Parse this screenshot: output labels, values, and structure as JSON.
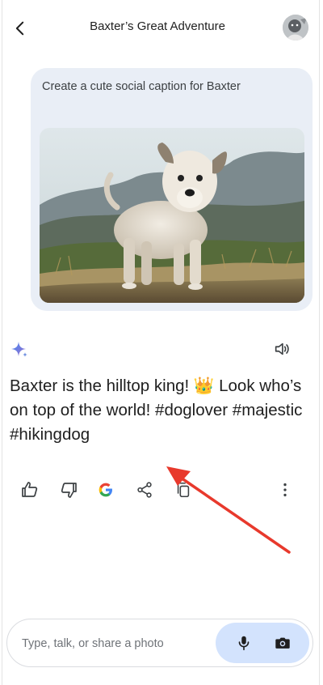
{
  "header": {
    "title": "Baxter’s Great Adventure",
    "back_icon": "back-arrow-icon",
    "avatar": "profile-avatar"
  },
  "prompt": {
    "text": "Create a cute social caption for Baxter",
    "image": "dog-standing-on-hilltop-photo"
  },
  "response": {
    "sparkle_icon": "gemini-sparkle-icon",
    "speaker_icon": "speaker-icon",
    "text": "Baxter is the hilltop king! 👑 Look who’s on top of the world! #doglover #majestic #hikingdog"
  },
  "actions": [
    {
      "icon": "thumbs-up-icon"
    },
    {
      "icon": "thumbs-down-icon"
    },
    {
      "icon": "google-g-icon"
    },
    {
      "icon": "share-icon"
    },
    {
      "icon": "copy-icon"
    },
    {
      "icon": "more-vertical-icon"
    }
  ],
  "input": {
    "placeholder": "Type, talk, or share a photo",
    "value": ""
  },
  "colors": {
    "prompt_bg": "#e9eef6",
    "tools_bg": "#d3e3fd",
    "annotation_arrow": "#e8392c"
  }
}
